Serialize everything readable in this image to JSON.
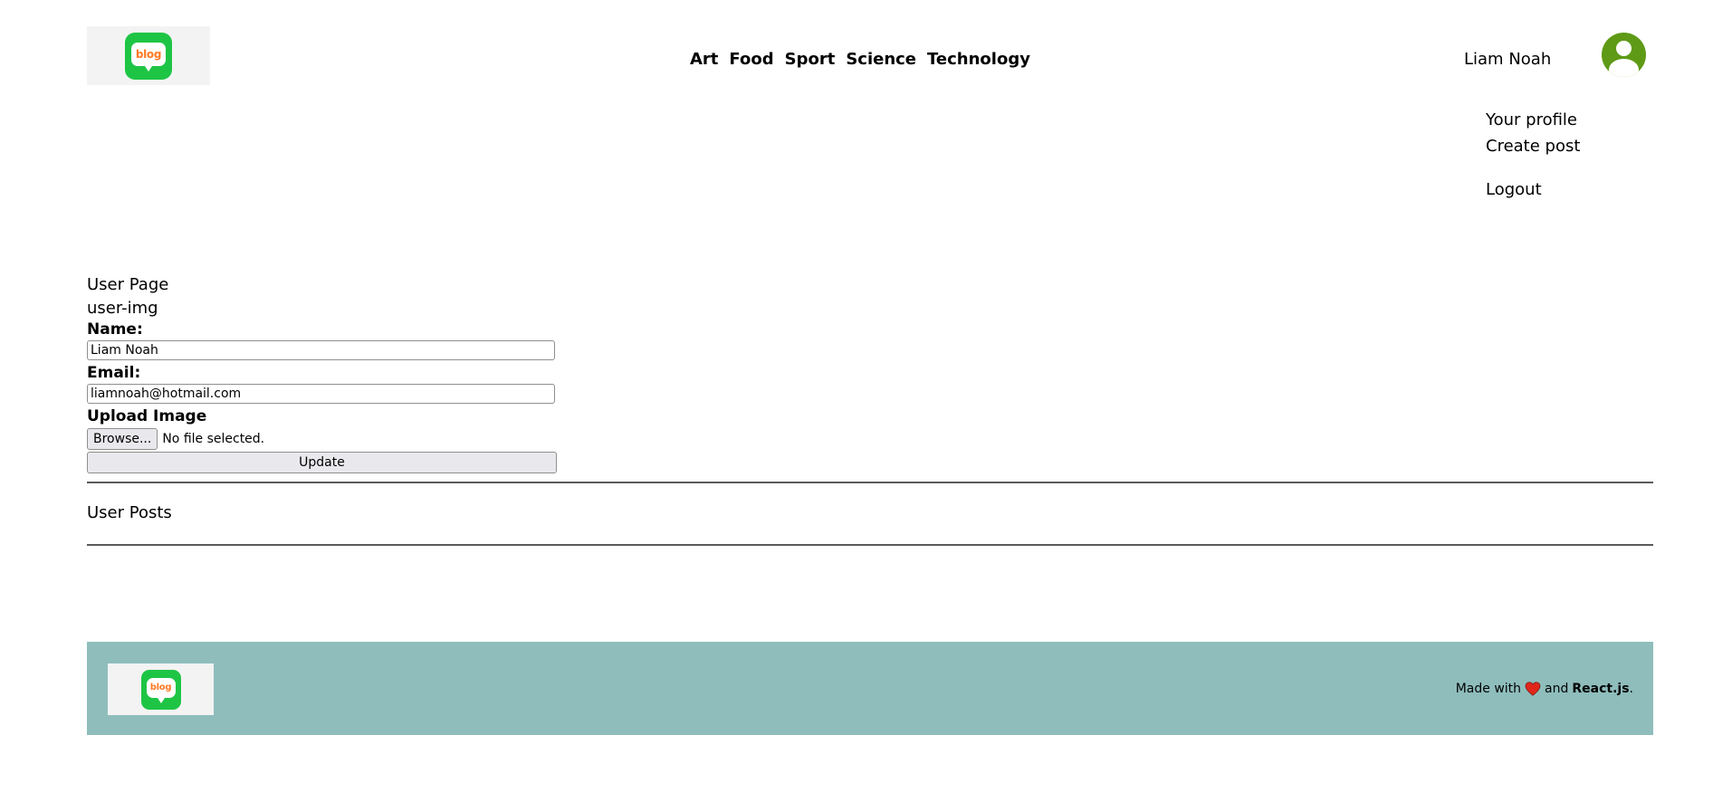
{
  "header": {
    "logo_text": "blog",
    "nav": [
      "Art",
      "Food",
      "Sport",
      "Science",
      "Technology"
    ],
    "user_name": "Liam Noah",
    "menu": {
      "profile": "Your profile",
      "create": "Create post",
      "logout": "Logout"
    }
  },
  "user_page": {
    "title": "User Page",
    "image_alt": "user-img",
    "name_label": "Name:",
    "name_value": "Liam Noah",
    "email_label": "Email:",
    "email_value": "liamnoah@hotmail.com",
    "upload_label": "Upload Image",
    "browse_label": "Browse...",
    "file_status": "No file selected.",
    "update_label": "Update",
    "posts_title": "User Posts"
  },
  "footer": {
    "logo_text": "blog",
    "made_with": "Made with",
    "and": "and",
    "framework": "React.js",
    "period": "."
  },
  "colors": {
    "brand_green": "#1ec545",
    "logo_orange": "#ff7a24",
    "avatar_green": "#5e9a16",
    "footer_bg": "#8ebdbc",
    "heart_red": "#e0261b"
  }
}
